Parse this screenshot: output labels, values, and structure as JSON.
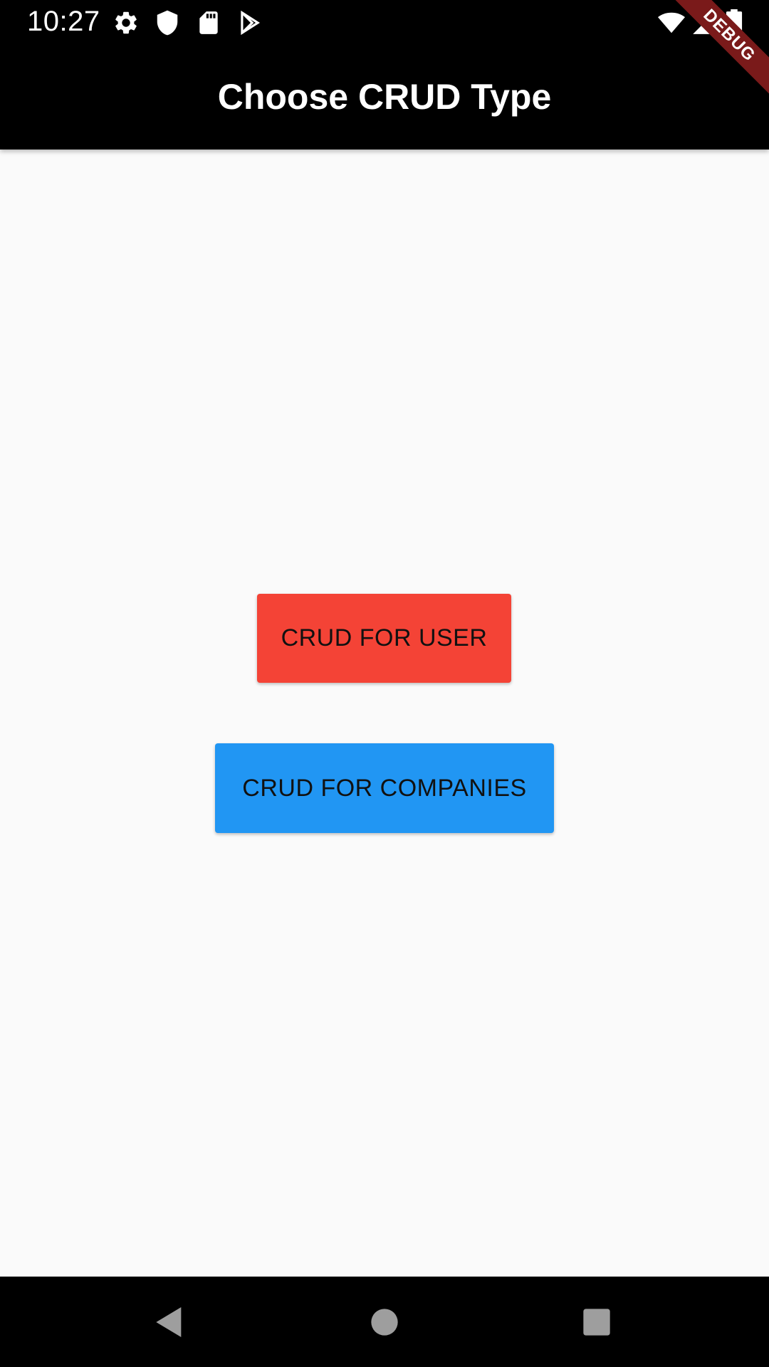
{
  "status_bar": {
    "time": "10:27",
    "left_icons": [
      "settings-icon",
      "shield-icon",
      "sd-card-icon",
      "play-store-icon"
    ],
    "right_icons": [
      "wifi-icon",
      "cell-signal-icon",
      "battery-icon"
    ]
  },
  "app_bar": {
    "title": "Choose CRUD Type"
  },
  "debug_banner": {
    "label": "DEBUG"
  },
  "buttons": {
    "user": {
      "label": "CRUD FOR USER",
      "color": "#f44336"
    },
    "companies": {
      "label": "CRUD FOR COMPANIES",
      "color": "#2196f3"
    }
  },
  "nav_bar": {
    "icons": [
      "back-icon",
      "home-icon",
      "recents-icon"
    ]
  },
  "colors": {
    "background": "#fafafa",
    "app_bar": "#000000",
    "debug_ribbon": "#7a1a1a"
  }
}
